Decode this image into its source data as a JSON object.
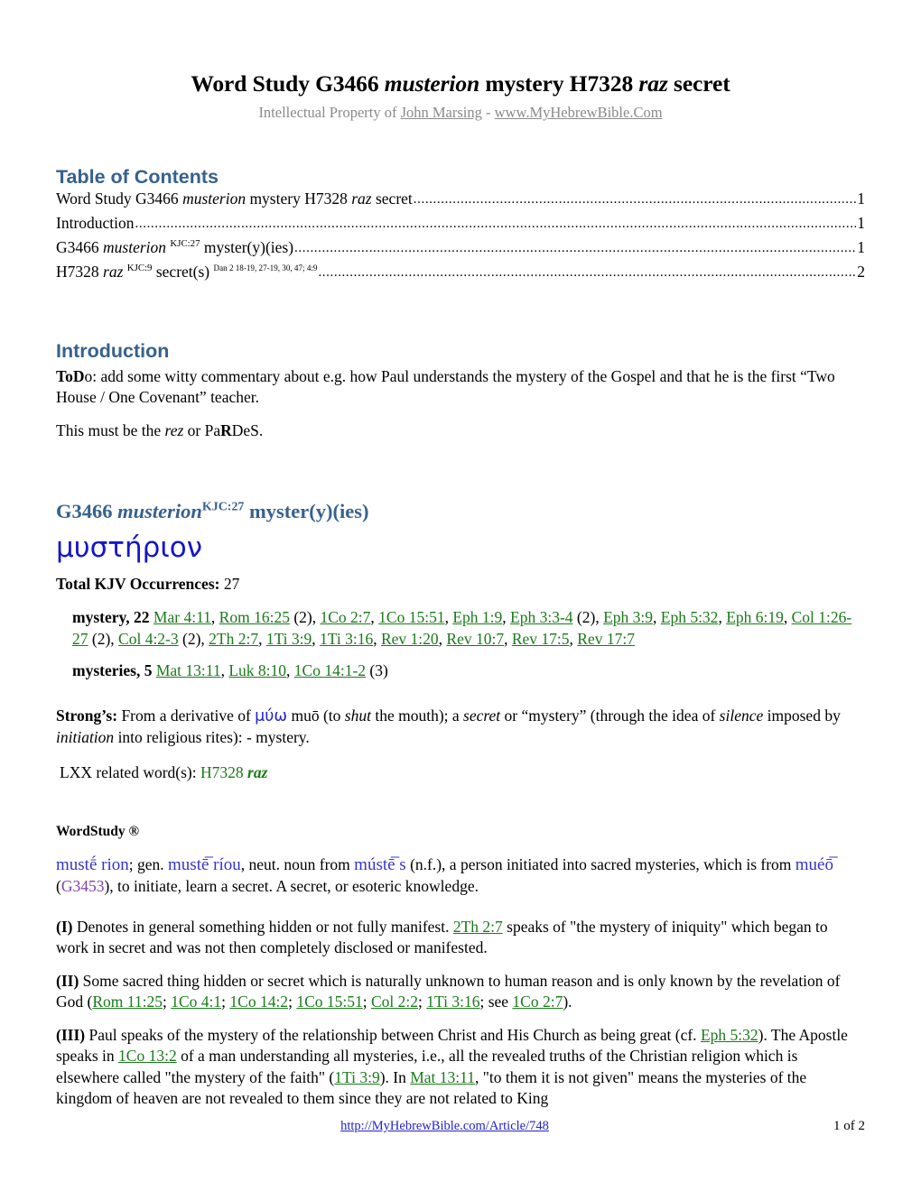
{
  "document": {
    "title_parts": {
      "p1": "Word Study G3466 ",
      "p2": "musterion",
      "p3": " mystery H7328 ",
      "p4": "raz",
      "p5": " secret"
    },
    "subtitle_parts": {
      "pre": "Intellectual Property of ",
      "author": "John Marsing",
      "sep": " - ",
      "site": "www.MyHebrewBible.Com"
    }
  },
  "toc": {
    "heading": "Table of Contents",
    "dots": "......................................................................................................................................................................................................",
    "entries": [
      {
        "lead": "Word Study G3466 ",
        "italic": "musterion",
        "mid": " mystery H7328 ",
        "italic2": "raz",
        "tail": " secret",
        "sup": "",
        "sup2": "",
        "page": "1"
      },
      {
        "lead": "Introduction",
        "italic": "",
        "mid": "",
        "italic2": "",
        "tail": "",
        "sup": "",
        "sup2": "",
        "page": "1"
      },
      {
        "lead": "G3466 ",
        "italic": "musterion",
        "mid": " ",
        "italic2": "",
        "tail": " myster(y)(ies)",
        "sup": "KJC:27",
        "sup2": "",
        "page": "1"
      },
      {
        "lead": "H7328 ",
        "italic": "raz",
        "mid": " ",
        "italic2": "",
        "tail": " secret(s) ",
        "sup": "KJC:9",
        "sup2": "Dan 2 18-19, 27-19, 30, 47; 4:9",
        "page": "2"
      }
    ]
  },
  "introduction": {
    "heading": "Introduction",
    "para1_bold": "ToD",
    "para1_rest": "o: add some witty commentary about e.g. how Paul understands the mystery of the Gospel and that he is the first “Two House / One Covenant” teacher.",
    "para2_pre": "This must be the ",
    "para2_italic": "rez",
    "para2_mid": " or Pa",
    "para2_bold": "R",
    "para2_post": "DeS."
  },
  "g3466": {
    "heading_pre": "G3466 ",
    "heading_italic": "musterion",
    "heading_sup": "KJC:27",
    "heading_post": " myster(y)(ies)",
    "greek": "μυστήριον",
    "total_label": "Total KJV Occurrences:",
    "total_value": "27",
    "occurrences": [
      {
        "word": "mystery,",
        "count": "22",
        "refs": [
          {
            "ref": "Mar 4:11",
            "note": ""
          },
          {
            "ref": "Rom 16:25",
            "note": " (2)"
          },
          {
            "ref": "1Co 2:7",
            "note": ""
          },
          {
            "ref": "1Co 15:51",
            "note": ""
          },
          {
            "ref": "Eph 1:9",
            "note": ""
          },
          {
            "ref": "Eph 3:3-4",
            "note": " (2)"
          },
          {
            "ref": "Eph 3:9",
            "note": ""
          },
          {
            "ref": "Eph 5:32",
            "note": ""
          },
          {
            "ref": "Eph 6:19",
            "note": ""
          },
          {
            "ref": "Col 1:26-27",
            "note": " (2)"
          },
          {
            "ref": "Col 4:2-3",
            "note": " (2)"
          },
          {
            "ref": "2Th 2:7",
            "note": ""
          },
          {
            "ref": "1Ti 3:9",
            "note": ""
          },
          {
            "ref": "1Ti 3:16",
            "note": ""
          },
          {
            "ref": "Rev 1:20",
            "note": ""
          },
          {
            "ref": "Rev 10:7",
            "note": ""
          },
          {
            "ref": "Rev 17:5",
            "note": ""
          },
          {
            "ref": "Rev 17:7",
            "note": ""
          }
        ]
      },
      {
        "word": "mysteries,",
        "count": "5",
        "refs": [
          {
            "ref": "Mat 13:11",
            "note": ""
          },
          {
            "ref": "Luk 8:10",
            "note": ""
          },
          {
            "ref": "1Co 14:1-2",
            "note": " (3)"
          }
        ]
      }
    ],
    "strongs": {
      "label": "Strong’s:",
      "t1": " From a derivative of ",
      "greek": "μύω",
      "t2": " muō  (to ",
      "i1": "shut",
      "t3": " the mouth); a ",
      "i2": "secret",
      "t4": " or “mystery” (through the idea of ",
      "i3": "silence",
      "t5": " imposed by ",
      "i4": "initiation",
      "t6": " into religious rites): - mystery."
    },
    "lxx": {
      "label": " LXX related word(s): ",
      "ref": "H7328",
      "italic": " raz"
    },
    "wordstudy": {
      "heading": "WordStudy ®",
      "w1": "mustḗ rion",
      "t1": "; gen. ",
      "w2": "mustē̅ ríou",
      "t2": ", neut. noun from ",
      "w3": "mústē̅ s",
      "t3": " (n.f.), a person initiated into sacred mysteries, which is from ",
      "w4": "muéō̅",
      "t4": "  (",
      "gref": "G3453",
      "t5": "), to initiate, learn a secret. A secret, or esoteric knowledge."
    },
    "definitions": [
      {
        "marker": "(I)",
        "segments": [
          {
            "type": "text",
            "value": " Denotes in general something hidden or not fully manifest. "
          },
          {
            "type": "ref",
            "value": "2Th 2:7"
          },
          {
            "type": "text",
            "value": " speaks of \"the mystery of iniquity\" which began to work in secret and was not then completely disclosed or manifested."
          }
        ]
      },
      {
        "marker": "(II)",
        "segments": [
          {
            "type": "text",
            "value": " Some sacred thing hidden or secret which is naturally unknown to human reason and is only known by the revelation of God ("
          },
          {
            "type": "ref",
            "value": "Rom 11:25"
          },
          {
            "type": "text",
            "value": "; "
          },
          {
            "type": "ref",
            "value": "1Co 4:1"
          },
          {
            "type": "text",
            "value": "; "
          },
          {
            "type": "ref",
            "value": "1Co 14:2"
          },
          {
            "type": "text",
            "value": "; "
          },
          {
            "type": "ref",
            "value": "1Co 15:51"
          },
          {
            "type": "text",
            "value": "; "
          },
          {
            "type": "ref",
            "value": "Col 2:2"
          },
          {
            "type": "text",
            "value": "; "
          },
          {
            "type": "ref",
            "value": "1Ti 3:16"
          },
          {
            "type": "text",
            "value": "; see "
          },
          {
            "type": "ref",
            "value": "1Co 2:7"
          },
          {
            "type": "text",
            "value": ")."
          }
        ]
      },
      {
        "marker": "(III)",
        "segments": [
          {
            "type": "text",
            "value": " Paul speaks of the mystery of the relationship between Christ and His Church as being great (cf. "
          },
          {
            "type": "ref",
            "value": "Eph 5:32"
          },
          {
            "type": "text",
            "value": "). The Apostle speaks in "
          },
          {
            "type": "ref",
            "value": "1Co 13:2"
          },
          {
            "type": "text",
            "value": " of a man understanding all mysteries, i.e., all the revealed truths of the Christian religion which is elsewhere called \"the mystery of the faith\" ("
          },
          {
            "type": "ref",
            "value": "1Ti 3:9"
          },
          {
            "type": "text",
            "value": "). In "
          },
          {
            "type": "ref",
            "value": "Mat 13:11"
          },
          {
            "type": "text",
            "value": ", \"to them it is not given\" means the mysteries of the kingdom of heaven are not revealed to them since they are not related to King"
          }
        ]
      }
    ]
  },
  "footer": {
    "url": "http://MyHebrewBible.com/Article/748",
    "page": "1 of 2"
  },
  "colors": {
    "heading_blue": "#36618e",
    "greek_blue": "#1515cc",
    "ref_green": "#1a7a1a",
    "gref_purple": "#8040b0",
    "subtitle_gray": "#8a8a8a"
  }
}
